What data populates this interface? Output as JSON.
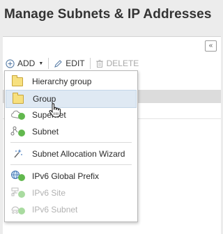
{
  "page": {
    "title": "Manage Subnets & IP Addresses"
  },
  "toolbar": {
    "add_label": "ADD",
    "edit_label": "EDIT",
    "delete_label": "DELETE",
    "collapse_icon": "double-chevron-left-icon"
  },
  "add_menu": {
    "items": [
      {
        "label": "Hierarchy group",
        "icon": "folder-icon",
        "state": "enabled"
      },
      {
        "label": "Group",
        "icon": "folder-icon",
        "state": "hovered"
      },
      {
        "label": "Supernet",
        "icon": "cloud-icon",
        "state": "enabled"
      },
      {
        "label": "Subnet",
        "icon": "network-nodes-icon",
        "state": "enabled"
      },
      {
        "label": "Subnet Allocation Wizard",
        "icon": "magic-wand-icon",
        "state": "enabled"
      },
      {
        "label": "IPv6 Global Prefix",
        "icon": "globe-icon",
        "state": "enabled"
      },
      {
        "label": "IPv6 Site",
        "icon": "site-icon",
        "state": "disabled"
      },
      {
        "label": "IPv6 Subnet",
        "icon": "ipv6-subnet-icon",
        "state": "disabled"
      }
    ]
  },
  "colors": {
    "status_green": "#62b84e",
    "hover_bg": "#dfe9f3",
    "folder_yellow": "#f7e07f"
  }
}
